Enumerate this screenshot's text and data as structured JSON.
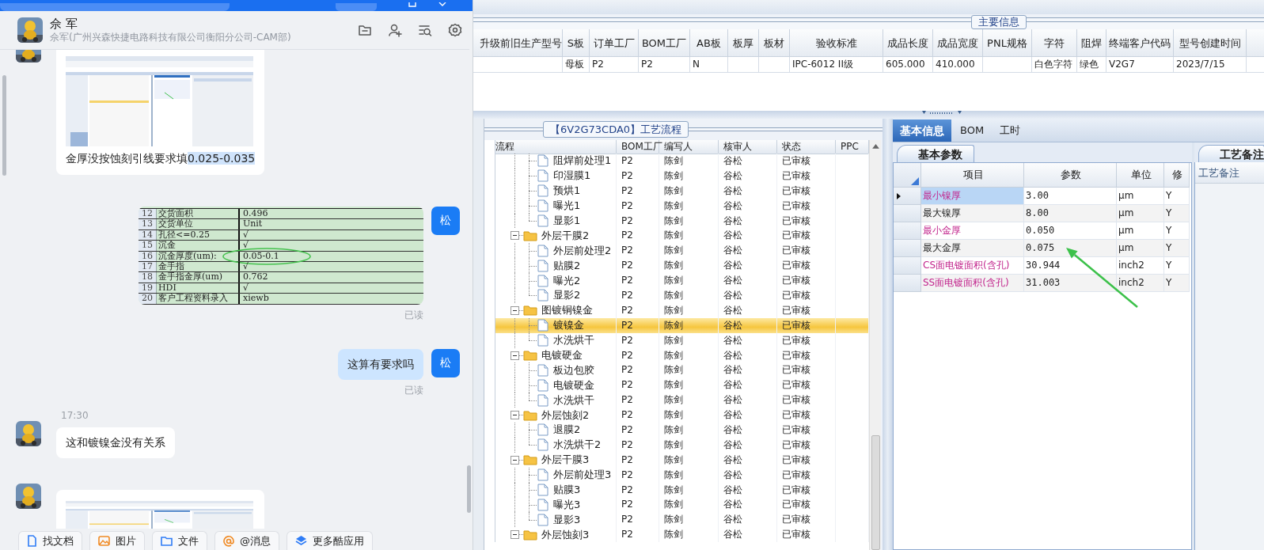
{
  "chat": {
    "contact": {
      "name": "佘 军",
      "subtitle": "佘军(广州兴森快捷电路科技有限公司衡阳分公司-CAM部)"
    },
    "messages": [
      {
        "kind": "image_text",
        "outgoing": false,
        "parts": [
          {
            "text": "金厚没按蚀刻引线要求填",
            "highlighted": false
          },
          {
            "text": "0.025-0.035",
            "highlighted": true
          }
        ]
      },
      {
        "kind": "sheet",
        "outgoing": true,
        "avatar": "松",
        "status": "已读",
        "rows": [
          {
            "index": "12",
            "label": "交货面积",
            "value": "0.496",
            "circled": false
          },
          {
            "index": "13",
            "label": "交货单位",
            "value": "Unit",
            "circled": false
          },
          {
            "index": "14",
            "label": "孔径<=0.25",
            "value": "√",
            "circled": false
          },
          {
            "index": "15",
            "label": "沉金",
            "value": "√",
            "circled": false
          },
          {
            "index": "16",
            "label": "沉金厚度(um):",
            "value": "0.05-0.1",
            "circled": true
          },
          {
            "index": "17",
            "label": "金手指",
            "value": "√",
            "circled": false
          },
          {
            "index": "18",
            "label": "金手指金厚(um)",
            "value": "0.762",
            "circled": false
          },
          {
            "index": "19",
            "label": "HDI",
            "value": "√",
            "circled": false
          },
          {
            "index": "20",
            "label": "客户工程资料录入",
            "value": "xiewb",
            "circled": false
          }
        ]
      },
      {
        "kind": "text",
        "outgoing": true,
        "avatar": "松",
        "text": "这算有要求吗",
        "status": "已读"
      },
      {
        "kind": "text",
        "outgoing": false,
        "time": "17:30",
        "text": "这和镀镍金没有关系"
      },
      {
        "kind": "image",
        "outgoing": false
      }
    ],
    "toolbar": [
      "找文档",
      "图片",
      "文件",
      "@消息",
      "更多酷应用"
    ]
  },
  "main_info": {
    "title": "主要信息",
    "columns": [
      "升级前旧生产型号",
      "S板",
      "订单工厂",
      "BOM工厂",
      "AB板",
      "板厚",
      "板材",
      "验收标准",
      "成品长度",
      "成品宽度",
      "PNL规格",
      "字符",
      "阻焊",
      "终端客户代码",
      "型号创建时间"
    ],
    "rows": [
      [
        null,
        "母板",
        "P2",
        "P2",
        "N",
        null,
        null,
        "IPC-6012 II级",
        "605.000",
        "410.000",
        null,
        "白色字符",
        "绿色",
        "V2G7",
        "2023/7/15"
      ]
    ]
  },
  "process": {
    "title": "【6V2G73CDA0】工艺流程",
    "columns": [
      "流程",
      "BOM工厂",
      "编写人",
      "核审人",
      "状态",
      "PPC"
    ],
    "nodes": [
      {
        "kind": "continued",
        "children": [
          {
            "kind": "step",
            "label": "阻焊前处理1",
            "bom": "P2",
            "writer": "陈剑",
            "reviewer": "谷松",
            "status": "已审核",
            "selected": false
          },
          {
            "kind": "step",
            "label": "印湿膜1",
            "bom": "P2",
            "writer": "陈剑",
            "reviewer": "谷松",
            "status": "已审核",
            "selected": false
          },
          {
            "kind": "step",
            "label": "预烘1",
            "bom": "P2",
            "writer": "陈剑",
            "reviewer": "谷松",
            "status": "已审核",
            "selected": false
          },
          {
            "kind": "step",
            "label": "曝光1",
            "bom": "P2",
            "writer": "陈剑",
            "reviewer": "谷松",
            "status": "已审核",
            "selected": false
          },
          {
            "kind": "step",
            "label": "显影1",
            "bom": "P2",
            "writer": "陈剑",
            "reviewer": "谷松",
            "status": "已审核",
            "selected": false
          }
        ]
      },
      {
        "kind": "folder",
        "label": "外层干膜2",
        "bom": "P2",
        "writer": "陈剑",
        "reviewer": "谷松",
        "status": "已审核",
        "selected": false,
        "expanded": true,
        "children": [
          {
            "kind": "step",
            "label": "外层前处理2",
            "bom": "P2",
            "writer": "陈剑",
            "reviewer": "谷松",
            "status": "已审核",
            "selected": false
          },
          {
            "kind": "step",
            "label": "贴膜2",
            "bom": "P2",
            "writer": "陈剑",
            "reviewer": "谷松",
            "status": "已审核",
            "selected": false
          },
          {
            "kind": "step",
            "label": "曝光2",
            "bom": "P2",
            "writer": "陈剑",
            "reviewer": "谷松",
            "status": "已审核",
            "selected": false
          },
          {
            "kind": "step",
            "label": "显影2",
            "bom": "P2",
            "writer": "陈剑",
            "reviewer": "谷松",
            "status": "已审核",
            "selected": false
          }
        ]
      },
      {
        "kind": "folder",
        "label": "图镀铜镍金",
        "bom": "P2",
        "writer": "陈剑",
        "reviewer": "谷松",
        "status": "已审核",
        "selected": false,
        "expanded": true,
        "children": [
          {
            "kind": "step",
            "label": "镀镍金",
            "bom": "P2",
            "writer": "陈剑",
            "reviewer": "谷松",
            "status": "已审核",
            "selected": true
          },
          {
            "kind": "step",
            "label": "水洗烘干",
            "bom": "P2",
            "writer": "陈剑",
            "reviewer": "谷松",
            "status": "已审核",
            "selected": false
          }
        ]
      },
      {
        "kind": "folder",
        "label": "电镀硬金",
        "bom": "P2",
        "writer": "陈剑",
        "reviewer": "谷松",
        "status": "已审核",
        "selected": false,
        "expanded": true,
        "children": [
          {
            "kind": "step",
            "label": "板边包胶",
            "bom": "P2",
            "writer": "陈剑",
            "reviewer": "谷松",
            "status": "已审核",
            "selected": false
          },
          {
            "kind": "step",
            "label": "电镀硬金",
            "bom": "P2",
            "writer": "陈剑",
            "reviewer": "谷松",
            "status": "已审核",
            "selected": false
          },
          {
            "kind": "step",
            "label": "水洗烘干",
            "bom": "P2",
            "writer": "陈剑",
            "reviewer": "谷松",
            "status": "已审核",
            "selected": false
          }
        ]
      },
      {
        "kind": "folder",
        "label": "外层蚀刻2",
        "bom": "P2",
        "writer": "陈剑",
        "reviewer": "谷松",
        "status": "已审核",
        "selected": false,
        "expanded": true,
        "children": [
          {
            "kind": "step",
            "label": "退膜2",
            "bom": "P2",
            "writer": "陈剑",
            "reviewer": "谷松",
            "status": "已审核",
            "selected": false
          },
          {
            "kind": "step",
            "label": "水洗烘干2",
            "bom": "P2",
            "writer": "陈剑",
            "reviewer": "谷松",
            "status": "已审核",
            "selected": false
          }
        ]
      },
      {
        "kind": "folder",
        "label": "外层干膜3",
        "bom": "P2",
        "writer": "陈剑",
        "reviewer": "谷松",
        "status": "已审核",
        "selected": false,
        "expanded": true,
        "children": [
          {
            "kind": "step",
            "label": "外层前处理3",
            "bom": "P2",
            "writer": "陈剑",
            "reviewer": "谷松",
            "status": "已审核",
            "selected": false
          },
          {
            "kind": "step",
            "label": "贴膜3",
            "bom": "P2",
            "writer": "陈剑",
            "reviewer": "谷松",
            "status": "已审核",
            "selected": false
          },
          {
            "kind": "step",
            "label": "曝光3",
            "bom": "P2",
            "writer": "陈剑",
            "reviewer": "谷松",
            "status": "已审核",
            "selected": false
          },
          {
            "kind": "step",
            "label": "显影3",
            "bom": "P2",
            "writer": "陈剑",
            "reviewer": "谷松",
            "status": "已审核",
            "selected": false
          }
        ]
      },
      {
        "kind": "folder",
        "label": "外层蚀刻3",
        "bom": "P2",
        "writer": "陈剑",
        "reviewer": "谷松",
        "status": "已审核",
        "selected": false,
        "expanded": true
      }
    ]
  },
  "detail": {
    "tabs": [
      {
        "label": "基本信息",
        "selected": true
      },
      {
        "label": "BOM",
        "selected": false
      },
      {
        "label": "工时",
        "selected": false
      }
    ],
    "panel_title": "基本参数",
    "columns": [
      "项目",
      "参数",
      "单位",
      "修"
    ],
    "rows": [
      {
        "item": "最小镍厚",
        "value": "3.00",
        "unit": "μm",
        "flag": "Y",
        "emphasized": true,
        "current": true
      },
      {
        "item": "最大镍厚",
        "value": "8.00",
        "unit": "μm",
        "flag": "Y",
        "emphasized": false,
        "current": false
      },
      {
        "item": "最小金厚",
        "value": "0.050",
        "unit": "μm",
        "flag": "Y",
        "emphasized": true,
        "current": false
      },
      {
        "item": "最大金厚",
        "value": "0.075",
        "unit": "μm",
        "flag": "Y",
        "emphasized": false,
        "current": false
      },
      {
        "item": "CS面电镀面积(含孔)",
        "value": "30.944",
        "unit": "inch2",
        "flag": "Y",
        "emphasized": true,
        "current": false
      },
      {
        "item": "SS面电镀面积(含孔)",
        "value": "31.003",
        "unit": "inch2",
        "flag": "Y",
        "emphasized": true,
        "current": false
      }
    ]
  },
  "notes": {
    "panel_title": "工艺备注",
    "column": "工艺备注"
  }
}
